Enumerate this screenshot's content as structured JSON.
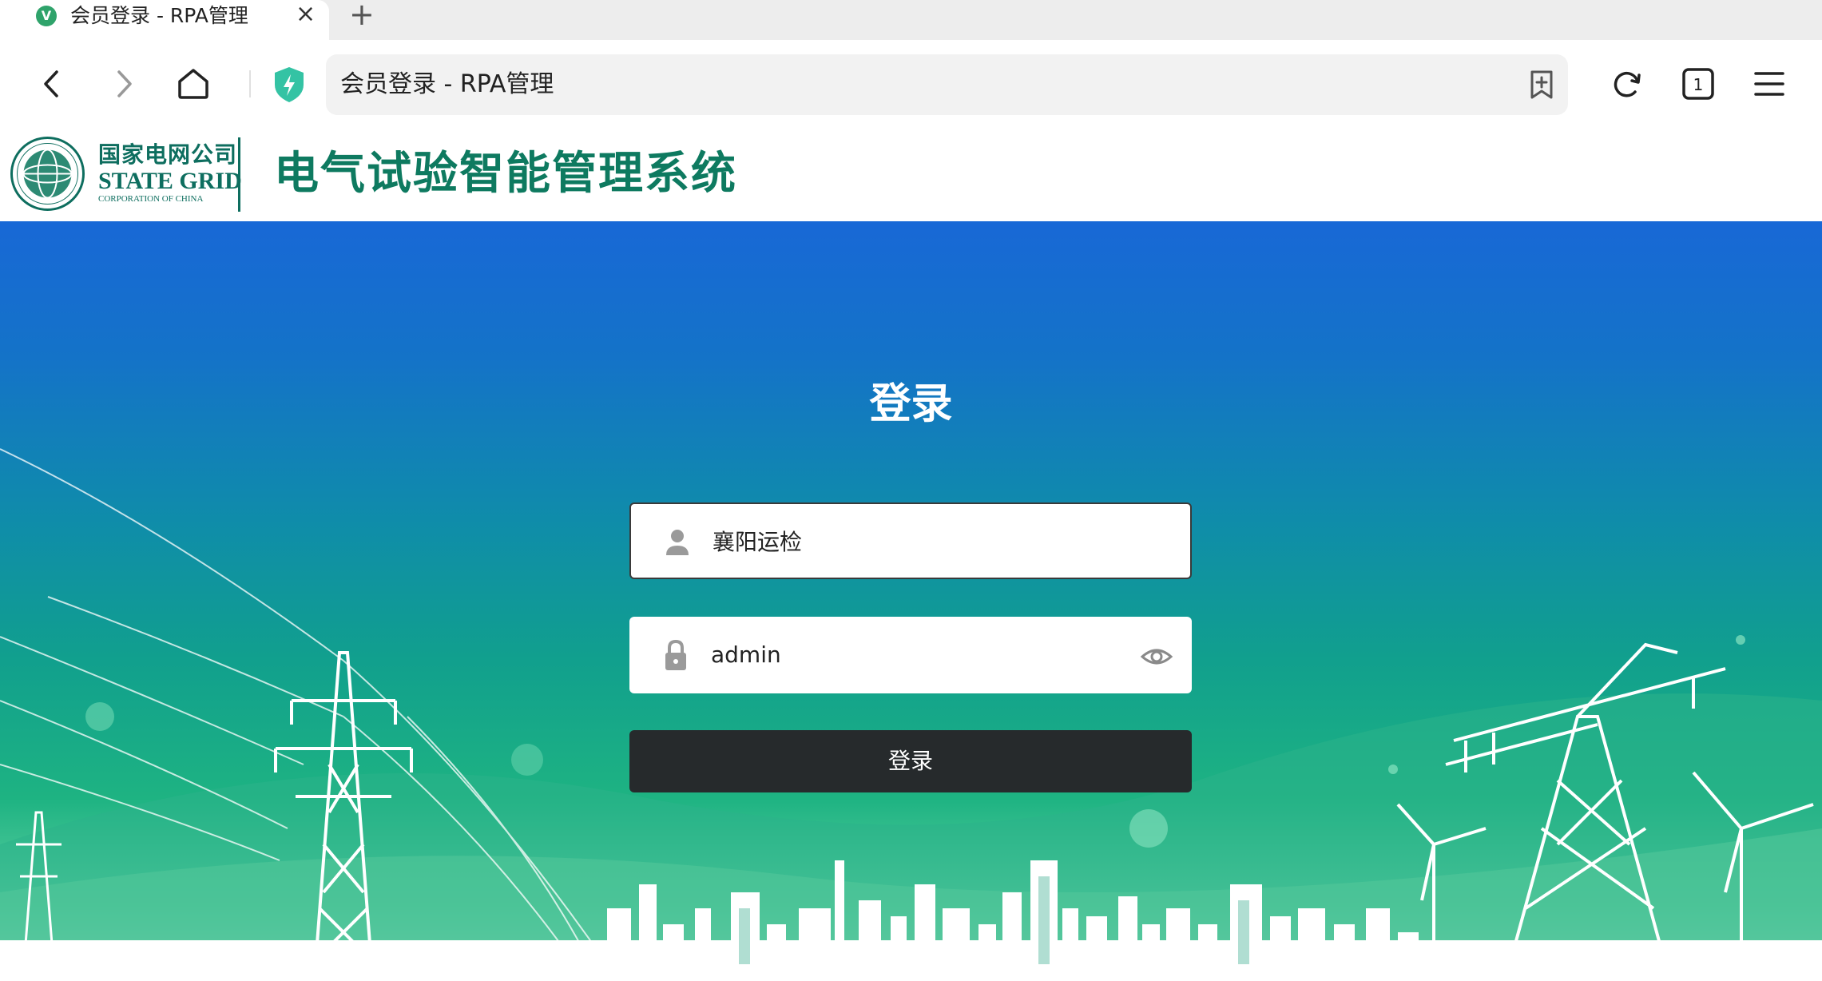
{
  "browser": {
    "tab": {
      "title": "会员登录 - RPA管理",
      "close_label": "×",
      "favicon": "vue-leaf-icon"
    },
    "new_tab_label": "+",
    "address_bar": {
      "text": "会员登录 - RPA管理"
    },
    "tab_count": "1",
    "icons": [
      "back-icon",
      "forward-icon",
      "home-icon",
      "shield-icon",
      "bookmark-add-icon",
      "reload-icon",
      "tab-switcher-icon",
      "menu-icon"
    ]
  },
  "header": {
    "logo": {
      "cn": "国家电网公司",
      "en": "STATE GRID",
      "sub": "CORPORATION OF CHINA",
      "seal_text": "STATE GRID CORPORATION OF CHINA"
    },
    "system_title": "电气试验智能管理系统"
  },
  "login": {
    "title": "登录",
    "username_value": "襄阳运检",
    "password_value": "admin",
    "submit_label": "登录"
  },
  "colors": {
    "brand_green": "#0e7a60",
    "button_dark": "#262a2c",
    "hero_top": "#1868d6",
    "hero_bottom": "#5fd0a2"
  }
}
